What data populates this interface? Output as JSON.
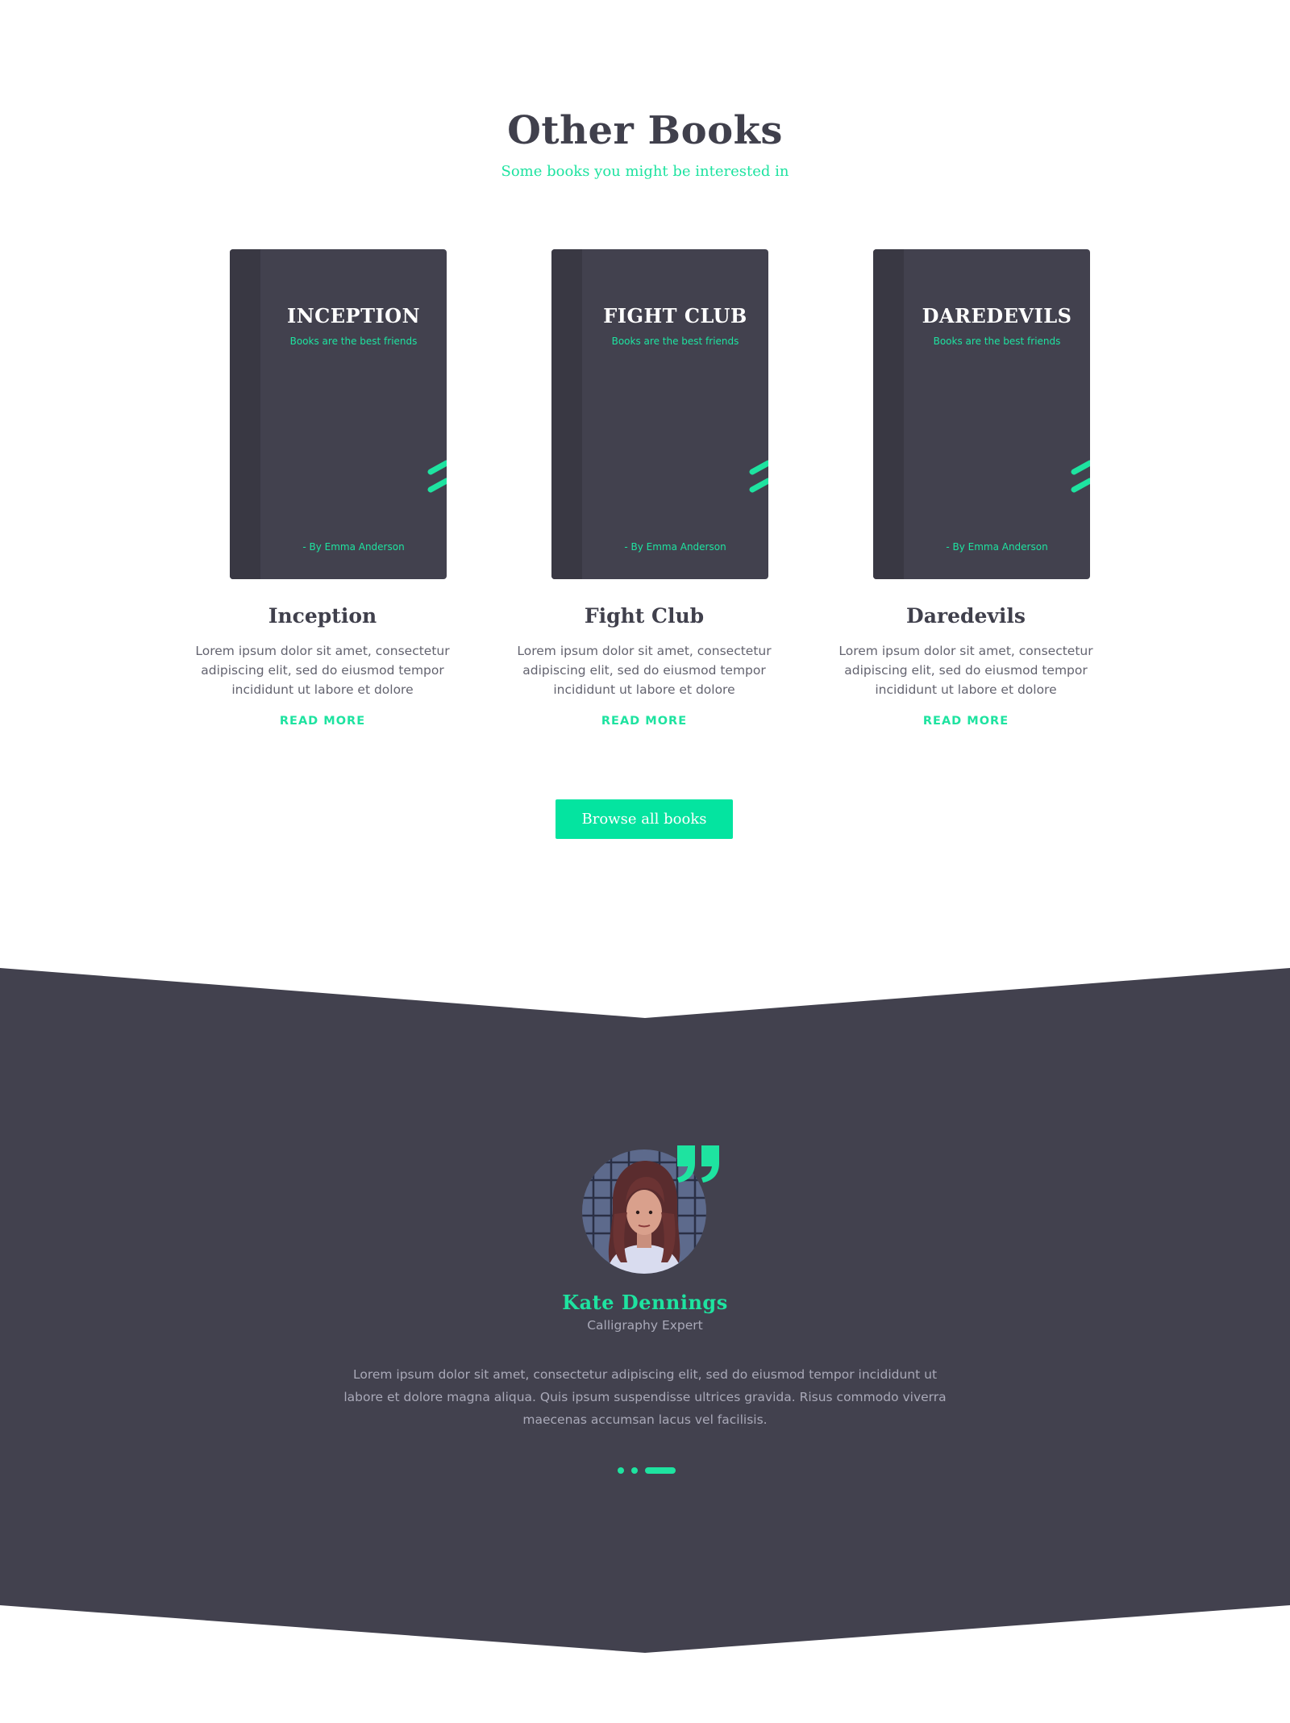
{
  "section": {
    "title": "Other Books",
    "subtitle": "Some books you might be interested in"
  },
  "books": [
    {
      "cover_title": "INCEPTION",
      "cover_tagline": "Books are the best friends",
      "cover_author": "- By Emma Anderson",
      "name": "Inception",
      "description": "Lorem ipsum dolor sit amet, consectetur adipiscing elit, sed do eiusmod tempor incididunt ut labore et dolore",
      "read_more": "READ MORE"
    },
    {
      "cover_title": "FIGHT CLUB",
      "cover_tagline": "Books are the best friends",
      "cover_author": "- By Emma Anderson",
      "name": "Fight Club",
      "description": "Lorem ipsum dolor sit amet, consectetur adipiscing elit, sed do eiusmod tempor incididunt ut labore et dolore",
      "read_more": "READ MORE"
    },
    {
      "cover_title": "DAREDEVILS",
      "cover_tagline": "Books are the best friends",
      "cover_author": "- By Emma Anderson",
      "name": "Daredevils",
      "description": "Lorem ipsum dolor sit amet, consectetur adipiscing elit, sed do eiusmod tempor incididunt ut labore et dolore",
      "read_more": "READ MORE"
    }
  ],
  "browse_button": "Browse all books",
  "testimonial": {
    "name": "Kate Dennings",
    "role": "Calligraphy Expert",
    "quote": "Lorem ipsum dolor sit amet, consectetur adipiscing elit, sed do eiusmod tempor incididunt ut labore et dolore magna aliqua. Quis ipsum suspendisse ultrices gravida. Risus commodo viverra maecenas accumsan lacus vel facilisis.",
    "quote_icon": "quote-icon",
    "slider": {
      "count": 3,
      "active": 3
    }
  },
  "colors": {
    "accent": "#1ee3a0",
    "button": "#04e4a0",
    "dark": "#42414e",
    "heading": "#40404c"
  }
}
